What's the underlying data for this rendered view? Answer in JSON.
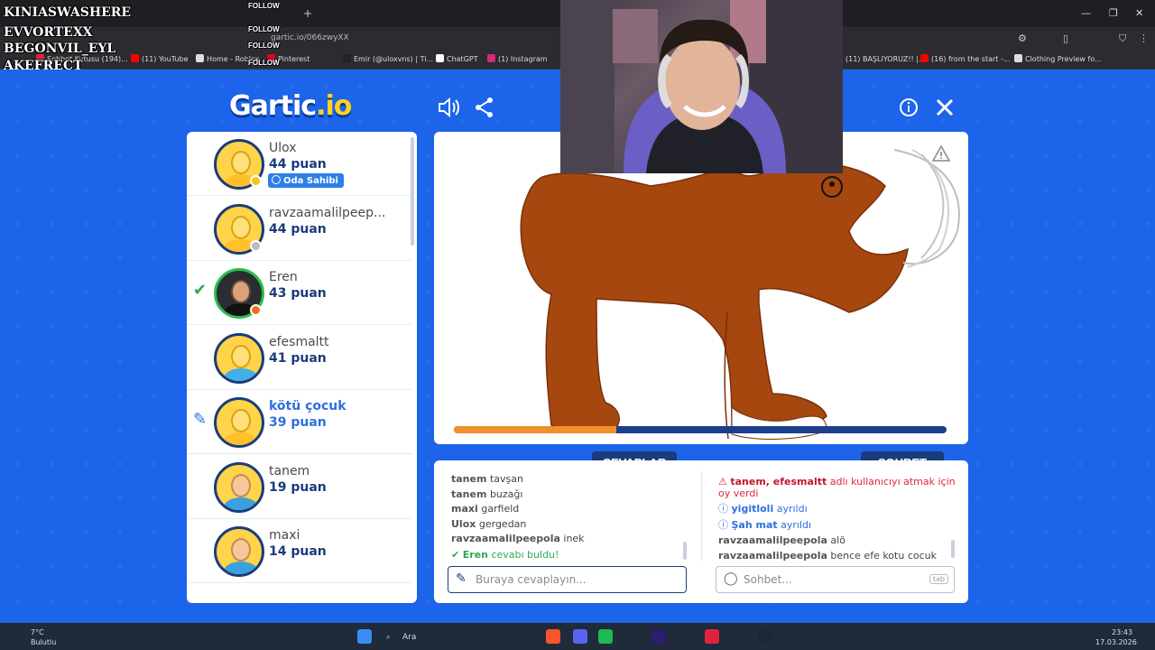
{
  "browser": {
    "url": "gartic.io/066zwyXX",
    "new_tab": "+",
    "win_min": "—",
    "win_max": "❐",
    "win_close": "✕",
    "bookmarks": [
      {
        "label": "Sohbet Kutusu (194)...",
        "color": "#e0233b"
      },
      {
        "label": "(11) YouTube",
        "color": "#ff0000"
      },
      {
        "label": "Home - Roblox",
        "color": "#ddd"
      },
      {
        "label": "Pinterest",
        "color": "#e60023"
      },
      {
        "label": "Emir (@uloxvns) | Ti...",
        "color": "#222"
      },
      {
        "label": "ChatGPT",
        "color": "#fff"
      },
      {
        "label": "(1) Instagram",
        "color": "#d62976"
      },
      {
        "label": "(11) BAŞLIYORUZ!! |...",
        "color": "#ff0000"
      },
      {
        "label": "(16) from the start -...",
        "color": "#ff0000"
      },
      {
        "label": "Clothing Preview fo...",
        "color": "#ddd"
      }
    ]
  },
  "stream_overlay": {
    "names": [
      "KINIASWASHERE",
      "EVVORTEXX",
      "BEGONVIL_EYL",
      "AKEFRECT"
    ],
    "follow_label": "FOLLOW"
  },
  "header": {
    "logo_main": "Gartic",
    "logo_suffix": ".io",
    "sound_icon": "speaker-icon",
    "share_icon": "share-icon",
    "info_icon": "info-icon",
    "close_icon": "close-icon"
  },
  "players": [
    {
      "name": "Ulox",
      "points": "44 puan",
      "owner_badge": "Oda Sahibi",
      "dot": "#f5c518",
      "avatar": "default"
    },
    {
      "name": "ravzaamalilpeep...",
      "points": "44 puan",
      "dot": "#bbbbbb",
      "avatar": "default"
    },
    {
      "name": "Eren",
      "points": "43 puan",
      "dot": "#e8731c",
      "avatar": "photo",
      "mark": "✔",
      "mark_color": "#2fa84f"
    },
    {
      "name": "efesmaltt",
      "points": "41 puan",
      "avatar": "efe"
    },
    {
      "name": "kötü çocuk",
      "points": "39 puan",
      "avatar": "default",
      "mark": "✎",
      "mark_color": "#2d6fe0",
      "drawing": true
    },
    {
      "name": "tanem",
      "points": "19 puan",
      "avatar": "tanem"
    },
    {
      "name": "maxi",
      "points": "14 puan",
      "avatar": "maxi"
    }
  ],
  "canvas": {
    "report_icon": "warning-icon",
    "timer_progress": 0.33,
    "drawing_colors": {
      "brown": "#a5470f",
      "gray": "#bdbdbd"
    }
  },
  "tabs": {
    "answers": "CEVAPLAR",
    "chat": "SOHBET"
  },
  "answers": [
    {
      "user": "tanem",
      "text": "tavşan"
    },
    {
      "user": "tanem",
      "text": "buzağı"
    },
    {
      "user": "maxi",
      "text": "garfield"
    },
    {
      "user": "Ulox",
      "text": "gergedan"
    },
    {
      "user": "ravzaamalilpeepola",
      "text": "inek"
    }
  ],
  "answer_found": {
    "user": "Eren",
    "text": "cevabı buldu!"
  },
  "answer_input": {
    "placeholder": "Buraya cevaplayın..."
  },
  "chat": {
    "kick_vote": {
      "users": "tanem, efesmaltt",
      "text": "adlı kullanıcıyı atmak için oy verdi"
    },
    "left_1": {
      "user": "yigitloli",
      "text": "ayrıldı"
    },
    "left_2": {
      "user": "Şah mat",
      "text": "ayrıldı"
    },
    "messages": [
      {
        "user": "ravzaamalilpeepola",
        "text": "alö"
      },
      {
        "user": "ravzaamalilpeepola",
        "text": "bence efe kotu cocuk"
      }
    ],
    "input": {
      "placeholder": "Sohbet...",
      "tab_key": "tab"
    }
  },
  "taskbar": {
    "weather_temp": "7°C",
    "weather_desc": "Bulutlu",
    "search": "Ara",
    "time": "23:43",
    "date": "17.03.2026"
  },
  "colors": {
    "brand_blue": "#1565e6",
    "navy": "#1a3c7a",
    "orange": "#f0902b",
    "green": "#2fa84f",
    "red": "#e0233b"
  }
}
